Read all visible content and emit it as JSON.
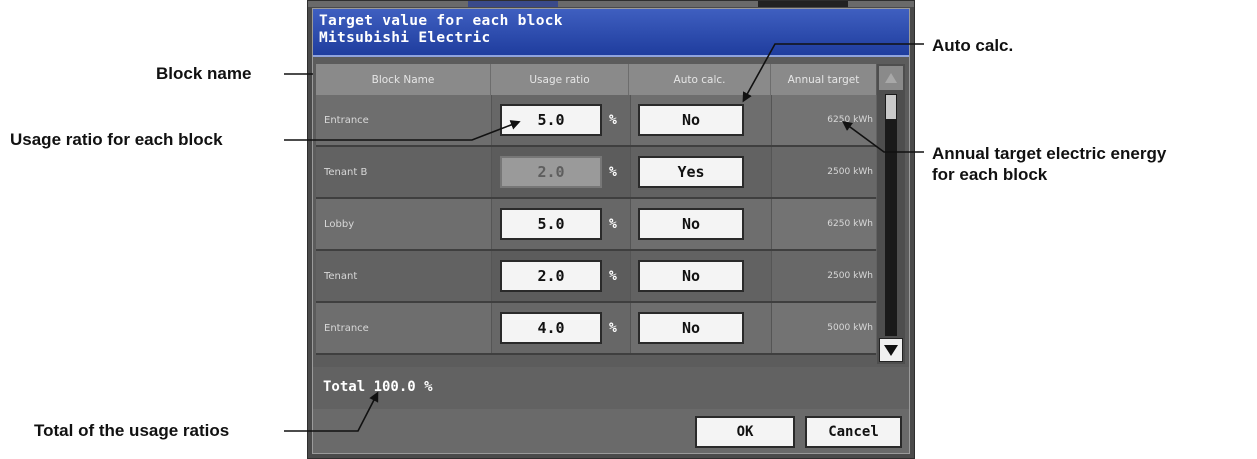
{
  "dialog": {
    "title_line1": "Target value for each block",
    "title_line2": "Mitsubishi Electric"
  },
  "table": {
    "headers": [
      "Block Name",
      "Usage ratio",
      "Auto calc.",
      "Annual target"
    ],
    "rows": [
      {
        "name": "Entrance",
        "ratio": "5.0",
        "auto": "No",
        "annual_value": "6250",
        "unit": "kWh",
        "ratio_disabled": false
      },
      {
        "name": "Tenant B",
        "ratio": "2.0",
        "auto": "Yes",
        "annual_value": "2500",
        "unit": "kWh",
        "ratio_disabled": true
      },
      {
        "name": "Lobby",
        "ratio": "5.0",
        "auto": "No",
        "annual_value": "6250",
        "unit": "kWh",
        "ratio_disabled": false
      },
      {
        "name": "Tenant",
        "ratio": "2.0",
        "auto": "No",
        "annual_value": "2500",
        "unit": "kWh",
        "ratio_disabled": false
      },
      {
        "name": "Entrance",
        "ratio": "4.0",
        "auto": "No",
        "annual_value": "5000",
        "unit": "kWh",
        "ratio_disabled": false
      }
    ],
    "percent_sign": "%"
  },
  "total": {
    "text": "Total 100.0 %"
  },
  "buttons": {
    "ok": "OK",
    "cancel": "Cancel"
  },
  "annotations": {
    "block_name": "Block name",
    "usage_ratio": "Usage ratio for each block",
    "total_ratios": "Total of the usage ratios",
    "auto_calc": "Auto calc.",
    "annual_line1": "Annual target electric energy",
    "annual_line2": "for each block"
  },
  "colors": {
    "title_bar": "#2a4bb0",
    "panel": "#5c5c5c",
    "button_face": "#f4f4f4"
  }
}
